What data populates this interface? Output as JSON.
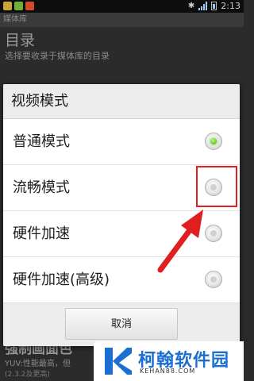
{
  "statusbar": {
    "time": "2:13"
  },
  "background": {
    "bar_title": "媒体库",
    "pref_title": "目录",
    "pref_summary": "选择要收录于媒体库的目录",
    "bottom_title": "强制画面色",
    "bottom_summary": "YUV:性能最高，但",
    "bottom_extra": "(2.3.2及更高)"
  },
  "dialog": {
    "title": "视频模式",
    "options": [
      {
        "label": "普通模式",
        "selected": true
      },
      {
        "label": "流畅模式",
        "selected": false
      },
      {
        "label": "硬件加速",
        "selected": false
      },
      {
        "label": "硬件加速(高级)",
        "selected": false
      }
    ],
    "cancel_label": "取消"
  },
  "watermark": {
    "name": "柯翰软件园",
    "url": "KEHAN88.COM"
  },
  "colors": {
    "highlight": "#e02020",
    "radio_selected": "#6fcf2e",
    "watermark_blue": "#1b6fd1"
  }
}
